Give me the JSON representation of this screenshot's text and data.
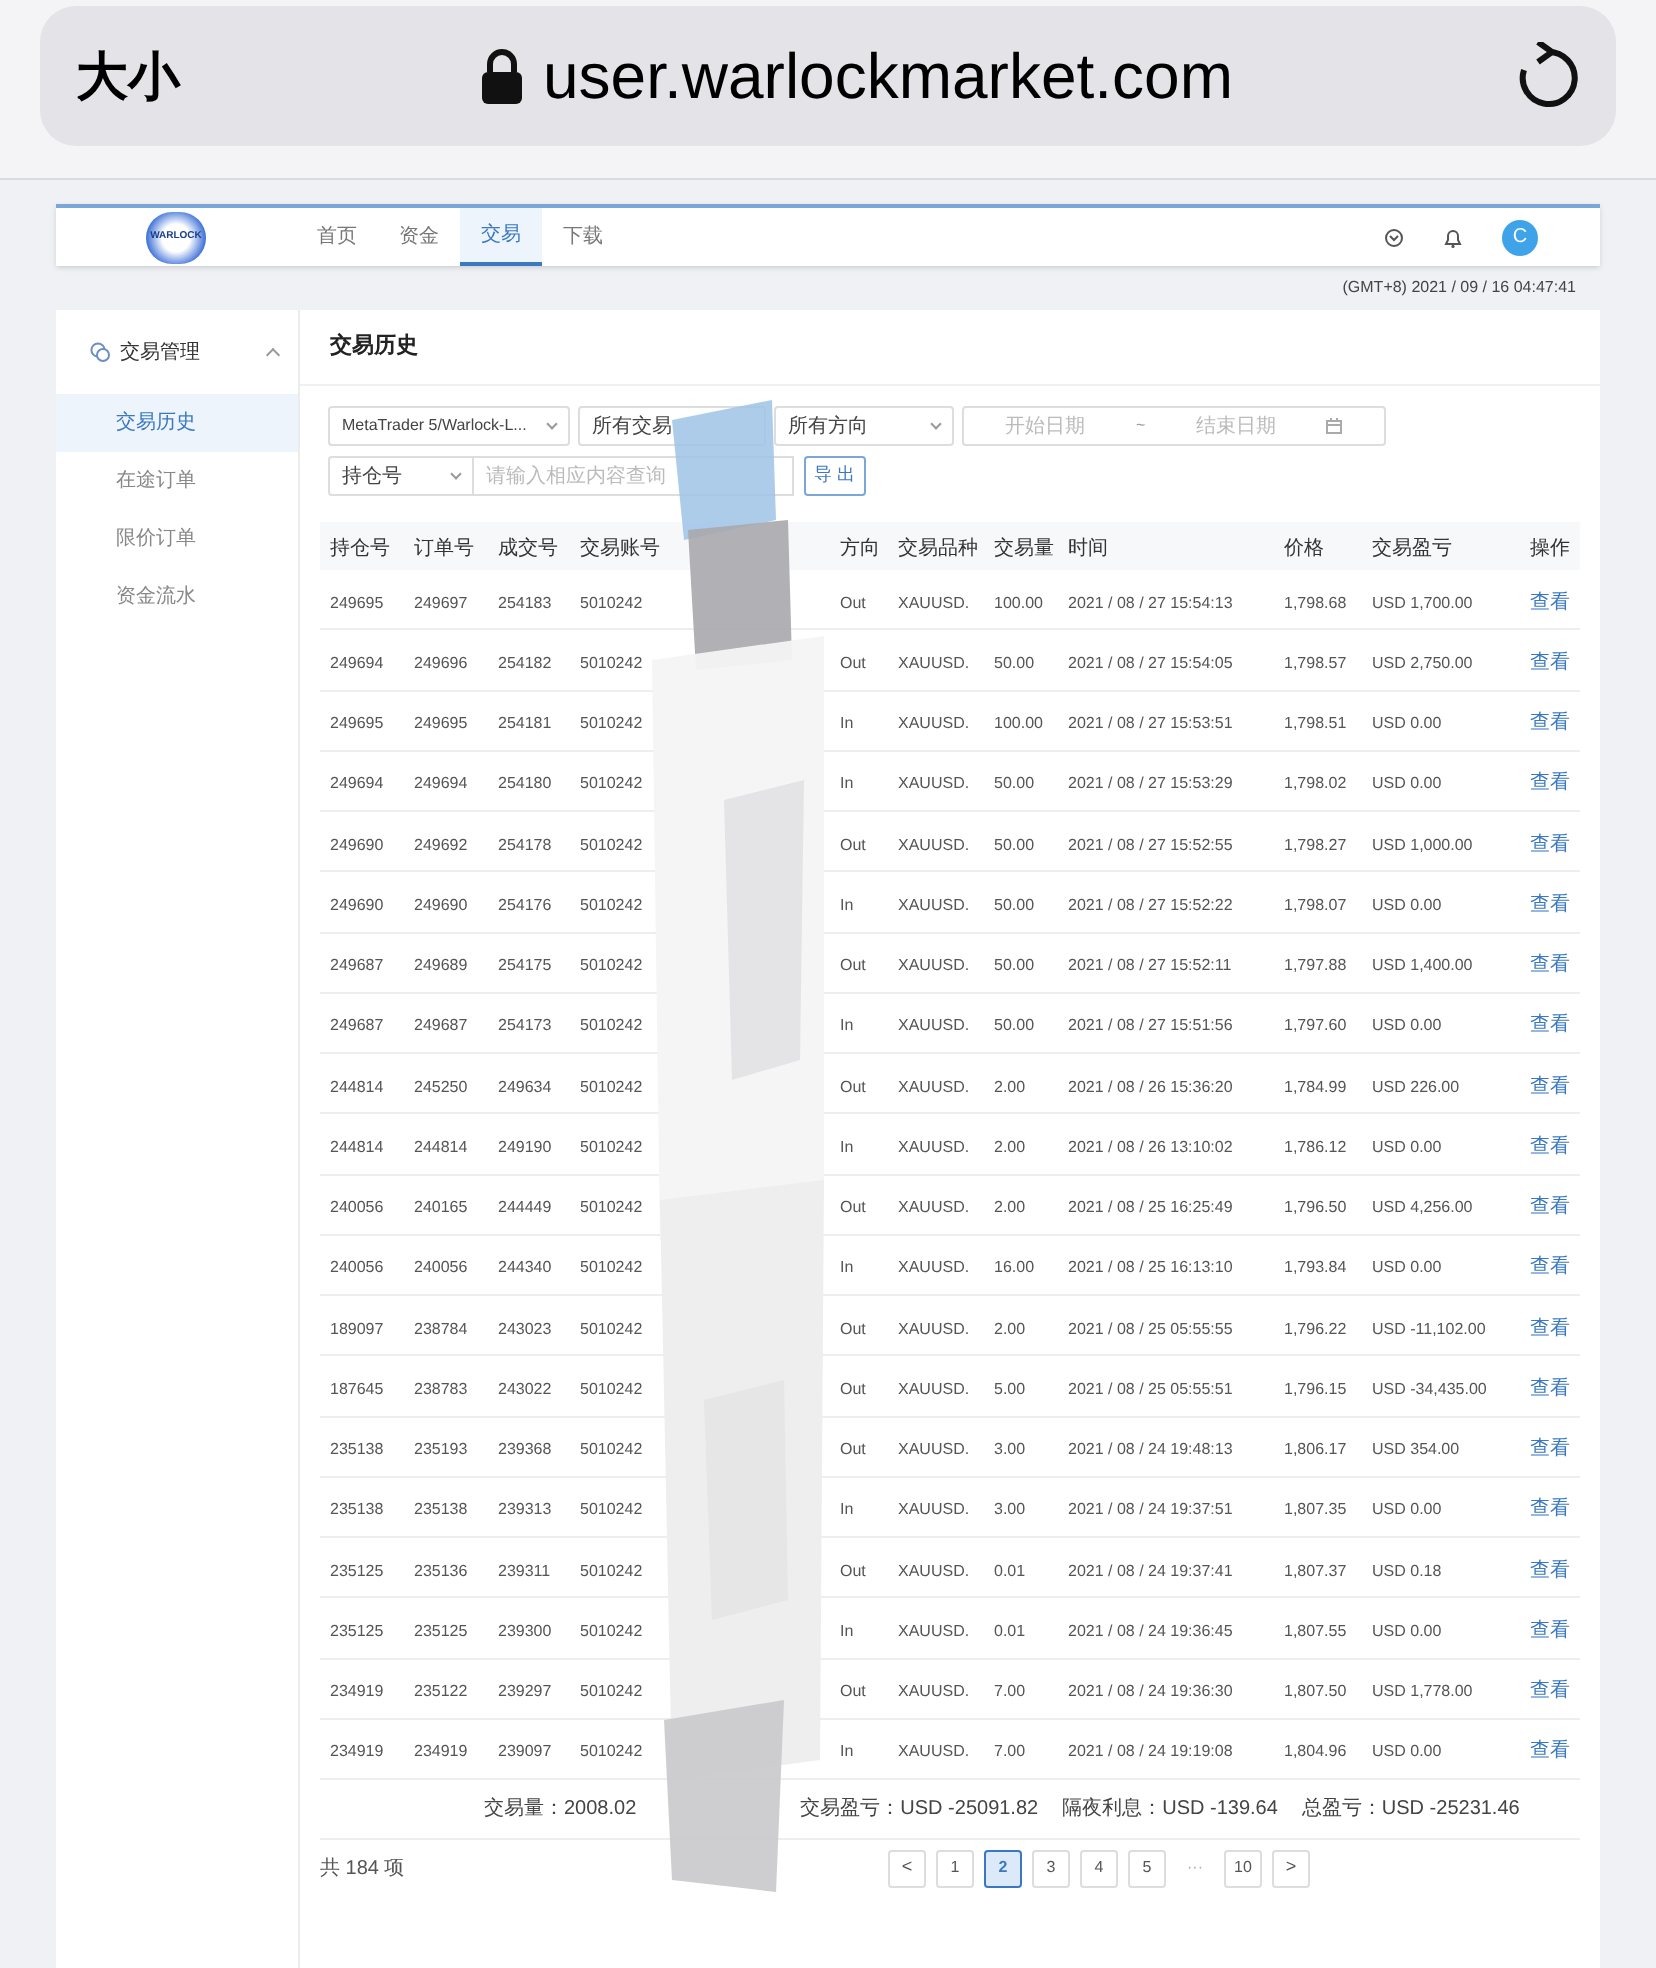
{
  "browser": {
    "text_size": "大小",
    "url": "user.warlockmarket.com"
  },
  "nav": {
    "logo_text": "WARLOCK",
    "items": [
      {
        "label": "首页",
        "selected": false
      },
      {
        "label": "资金",
        "selected": false
      },
      {
        "label": "交易",
        "selected": true
      },
      {
        "label": "下载",
        "selected": false
      }
    ],
    "avatar": "C"
  },
  "timestamp": "(GMT+8) 2021 / 09 / 16 04:47:41",
  "sidebar": {
    "group": {
      "label": "交易管理",
      "expanded": true
    },
    "items": [
      {
        "label": "交易历史",
        "selected": true
      },
      {
        "label": "在途订单",
        "selected": false
      },
      {
        "label": "限价订单",
        "selected": false
      },
      {
        "label": "资金流水",
        "selected": false
      }
    ]
  },
  "panel_title": "交易历史",
  "filters": {
    "account_select": "MetaTrader 5/Warlock-L...",
    "type_select": "所有交易",
    "direction_select": "所有方向",
    "start_placeholder": "开始日期",
    "range_separator": "~",
    "end_placeholder": "结束日期",
    "field_select": "持仓号",
    "search_placeholder": "请输入相应内容查询",
    "export_button": "导 出"
  },
  "table": {
    "columns": [
      "持仓号",
      "订单号",
      "成交号",
      "交易账号",
      "方向",
      "交易品种",
      "交易量",
      "时间",
      "价格",
      "交易盈亏",
      "操作"
    ],
    "rows": [
      [
        "249695",
        "249697",
        "254183",
        "5010242",
        "Out",
        "XAUUSD.",
        "100.00",
        "2021 / 08 / 27 15:54:13",
        "1,798.68",
        "USD 1,700.00",
        "查看"
      ],
      [
        "249694",
        "249696",
        "254182",
        "5010242",
        "Out",
        "XAUUSD.",
        "50.00",
        "2021 / 08 / 27 15:54:05",
        "1,798.57",
        "USD 2,750.00",
        "查看"
      ],
      [
        "249695",
        "249695",
        "254181",
        "5010242",
        "In",
        "XAUUSD.",
        "100.00",
        "2021 / 08 / 27 15:53:51",
        "1,798.51",
        "USD 0.00",
        "查看"
      ],
      [
        "249694",
        "249694",
        "254180",
        "5010242",
        "In",
        "XAUUSD.",
        "50.00",
        "2021 / 08 / 27 15:53:29",
        "1,798.02",
        "USD 0.00",
        "查看"
      ],
      [
        "249690",
        "249692",
        "254178",
        "5010242",
        "Out",
        "XAUUSD.",
        "50.00",
        "2021 / 08 / 27 15:52:55",
        "1,798.27",
        "USD 1,000.00",
        "查看"
      ],
      [
        "249690",
        "249690",
        "254176",
        "5010242",
        "In",
        "XAUUSD.",
        "50.00",
        "2021 / 08 / 27 15:52:22",
        "1,798.07",
        "USD 0.00",
        "查看"
      ],
      [
        "249687",
        "249689",
        "254175",
        "5010242",
        "Out",
        "XAUUSD.",
        "50.00",
        "2021 / 08 / 27 15:52:11",
        "1,797.88",
        "USD 1,400.00",
        "查看"
      ],
      [
        "249687",
        "249687",
        "254173",
        "5010242",
        "In",
        "XAUUSD.",
        "50.00",
        "2021 / 08 / 27 15:51:56",
        "1,797.60",
        "USD 0.00",
        "查看"
      ],
      [
        "244814",
        "245250",
        "249634",
        "5010242",
        "Out",
        "XAUUSD.",
        "2.00",
        "2021 / 08 / 26 15:36:20",
        "1,784.99",
        "USD 226.00",
        "查看"
      ],
      [
        "244814",
        "244814",
        "249190",
        "5010242",
        "In",
        "XAUUSD.",
        "2.00",
        "2021 / 08 / 26 13:10:02",
        "1,786.12",
        "USD 0.00",
        "查看"
      ],
      [
        "240056",
        "240165",
        "244449",
        "5010242",
        "Out",
        "XAUUSD.",
        "2.00",
        "2021 / 08 / 25 16:25:49",
        "1,796.50",
        "USD 4,256.00",
        "查看"
      ],
      [
        "240056",
        "240056",
        "244340",
        "5010242",
        "In",
        "XAUUSD.",
        "16.00",
        "2021 / 08 / 25 16:13:10",
        "1,793.84",
        "USD 0.00",
        "查看"
      ],
      [
        "189097",
        "238784",
        "243023",
        "5010242",
        "Out",
        "XAUUSD.",
        "2.00",
        "2021 / 08 / 25 05:55:55",
        "1,796.22",
        "USD -11,102.00",
        "查看"
      ],
      [
        "187645",
        "238783",
        "243022",
        "5010242",
        "Out",
        "XAUUSD.",
        "5.00",
        "2021 / 08 / 25 05:55:51",
        "1,796.15",
        "USD -34,435.00",
        "查看"
      ],
      [
        "235138",
        "235193",
        "239368",
        "5010242",
        "Out",
        "XAUUSD.",
        "3.00",
        "2021 / 08 / 24 19:48:13",
        "1,806.17",
        "USD 354.00",
        "查看"
      ],
      [
        "235138",
        "235138",
        "239313",
        "5010242",
        "In",
        "XAUUSD.",
        "3.00",
        "2021 / 08 / 24 19:37:51",
        "1,807.35",
        "USD 0.00",
        "查看"
      ],
      [
        "235125",
        "235136",
        "239311",
        "5010242",
        "Out",
        "XAUUSD.",
        "0.01",
        "2021 / 08 / 24 19:37:41",
        "1,807.37",
        "USD 0.18",
        "查看"
      ],
      [
        "235125",
        "235125",
        "239300",
        "5010242",
        "In",
        "XAUUSD.",
        "0.01",
        "2021 / 08 / 24 19:36:45",
        "1,807.55",
        "USD 0.00",
        "查看"
      ],
      [
        "234919",
        "235122",
        "239297",
        "5010242",
        "Out",
        "XAUUSD.",
        "7.00",
        "2021 / 08 / 24 19:36:30",
        "1,807.50",
        "USD 1,778.00",
        "查看"
      ],
      [
        "234919",
        "234919",
        "239097",
        "5010242",
        "In",
        "XAUUSD.",
        "7.00",
        "2021 / 08 / 24 19:19:08",
        "1,804.96",
        "USD 0.00",
        "查看"
      ]
    ]
  },
  "summary": [
    {
      "label": "交易量：",
      "value": "2008.02"
    },
    {
      "label": "交易盈亏：",
      "value": "USD -25091.82"
    },
    {
      "label": "隔夜利息：",
      "value": "USD -139.64"
    },
    {
      "label": "总盈亏：",
      "value": "USD -25231.46"
    }
  ],
  "pagination": {
    "total": "共 184 项",
    "prev": "<",
    "next": ">",
    "pages": [
      {
        "kind": "page",
        "label": "1",
        "selected": false
      },
      {
        "kind": "page",
        "label": "2",
        "selected": true
      },
      {
        "kind": "page",
        "label": "3",
        "selected": false
      },
      {
        "kind": "page",
        "label": "4",
        "selected": false
      },
      {
        "kind": "page",
        "label": "5",
        "selected": false
      },
      {
        "kind": "ellipsis",
        "label": "···",
        "selected": false
      },
      {
        "kind": "page",
        "label": "10",
        "selected": false
      }
    ]
  }
}
